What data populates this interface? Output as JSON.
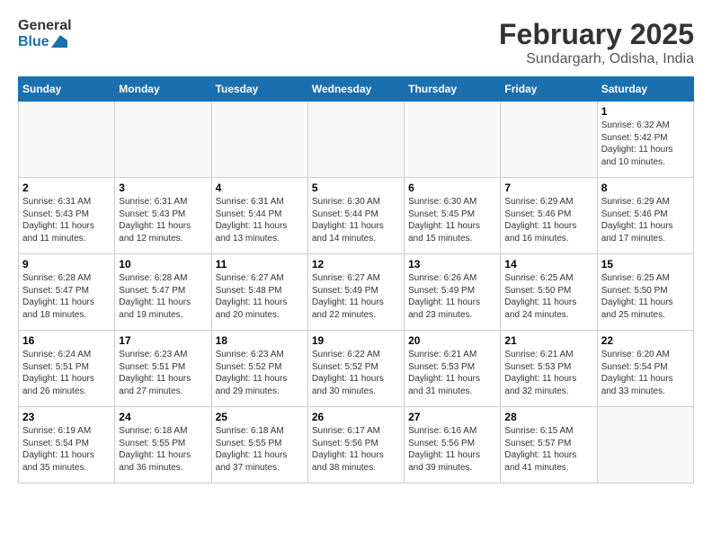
{
  "logo": {
    "line1": "General",
    "line2": "Blue"
  },
  "title": "February 2025",
  "subtitle": "Sundargarh, Odisha, India",
  "days_of_week": [
    "Sunday",
    "Monday",
    "Tuesday",
    "Wednesday",
    "Thursday",
    "Friday",
    "Saturday"
  ],
  "weeks": [
    [
      {
        "day": "",
        "info": ""
      },
      {
        "day": "",
        "info": ""
      },
      {
        "day": "",
        "info": ""
      },
      {
        "day": "",
        "info": ""
      },
      {
        "day": "",
        "info": ""
      },
      {
        "day": "",
        "info": ""
      },
      {
        "day": "1",
        "info": "Sunrise: 6:32 AM\nSunset: 5:42 PM\nDaylight: 11 hours and 10 minutes."
      }
    ],
    [
      {
        "day": "2",
        "info": "Sunrise: 6:31 AM\nSunset: 5:43 PM\nDaylight: 11 hours and 11 minutes."
      },
      {
        "day": "3",
        "info": "Sunrise: 6:31 AM\nSunset: 5:43 PM\nDaylight: 11 hours and 12 minutes."
      },
      {
        "day": "4",
        "info": "Sunrise: 6:31 AM\nSunset: 5:44 PM\nDaylight: 11 hours and 13 minutes."
      },
      {
        "day": "5",
        "info": "Sunrise: 6:30 AM\nSunset: 5:44 PM\nDaylight: 11 hours and 14 minutes."
      },
      {
        "day": "6",
        "info": "Sunrise: 6:30 AM\nSunset: 5:45 PM\nDaylight: 11 hours and 15 minutes."
      },
      {
        "day": "7",
        "info": "Sunrise: 6:29 AM\nSunset: 5:46 PM\nDaylight: 11 hours and 16 minutes."
      },
      {
        "day": "8",
        "info": "Sunrise: 6:29 AM\nSunset: 5:46 PM\nDaylight: 11 hours and 17 minutes."
      }
    ],
    [
      {
        "day": "9",
        "info": "Sunrise: 6:28 AM\nSunset: 5:47 PM\nDaylight: 11 hours and 18 minutes."
      },
      {
        "day": "10",
        "info": "Sunrise: 6:28 AM\nSunset: 5:47 PM\nDaylight: 11 hours and 19 minutes."
      },
      {
        "day": "11",
        "info": "Sunrise: 6:27 AM\nSunset: 5:48 PM\nDaylight: 11 hours and 20 minutes."
      },
      {
        "day": "12",
        "info": "Sunrise: 6:27 AM\nSunset: 5:49 PM\nDaylight: 11 hours and 22 minutes."
      },
      {
        "day": "13",
        "info": "Sunrise: 6:26 AM\nSunset: 5:49 PM\nDaylight: 11 hours and 23 minutes."
      },
      {
        "day": "14",
        "info": "Sunrise: 6:25 AM\nSunset: 5:50 PM\nDaylight: 11 hours and 24 minutes."
      },
      {
        "day": "15",
        "info": "Sunrise: 6:25 AM\nSunset: 5:50 PM\nDaylight: 11 hours and 25 minutes."
      }
    ],
    [
      {
        "day": "16",
        "info": "Sunrise: 6:24 AM\nSunset: 5:51 PM\nDaylight: 11 hours and 26 minutes."
      },
      {
        "day": "17",
        "info": "Sunrise: 6:23 AM\nSunset: 5:51 PM\nDaylight: 11 hours and 27 minutes."
      },
      {
        "day": "18",
        "info": "Sunrise: 6:23 AM\nSunset: 5:52 PM\nDaylight: 11 hours and 29 minutes."
      },
      {
        "day": "19",
        "info": "Sunrise: 6:22 AM\nSunset: 5:52 PM\nDaylight: 11 hours and 30 minutes."
      },
      {
        "day": "20",
        "info": "Sunrise: 6:21 AM\nSunset: 5:53 PM\nDaylight: 11 hours and 31 minutes."
      },
      {
        "day": "21",
        "info": "Sunrise: 6:21 AM\nSunset: 5:53 PM\nDaylight: 11 hours and 32 minutes."
      },
      {
        "day": "22",
        "info": "Sunrise: 6:20 AM\nSunset: 5:54 PM\nDaylight: 11 hours and 33 minutes."
      }
    ],
    [
      {
        "day": "23",
        "info": "Sunrise: 6:19 AM\nSunset: 5:54 PM\nDaylight: 11 hours and 35 minutes."
      },
      {
        "day": "24",
        "info": "Sunrise: 6:18 AM\nSunset: 5:55 PM\nDaylight: 11 hours and 36 minutes."
      },
      {
        "day": "25",
        "info": "Sunrise: 6:18 AM\nSunset: 5:55 PM\nDaylight: 11 hours and 37 minutes."
      },
      {
        "day": "26",
        "info": "Sunrise: 6:17 AM\nSunset: 5:56 PM\nDaylight: 11 hours and 38 minutes."
      },
      {
        "day": "27",
        "info": "Sunrise: 6:16 AM\nSunset: 5:56 PM\nDaylight: 11 hours and 39 minutes."
      },
      {
        "day": "28",
        "info": "Sunrise: 6:15 AM\nSunset: 5:57 PM\nDaylight: 11 hours and 41 minutes."
      },
      {
        "day": "",
        "info": ""
      }
    ]
  ]
}
